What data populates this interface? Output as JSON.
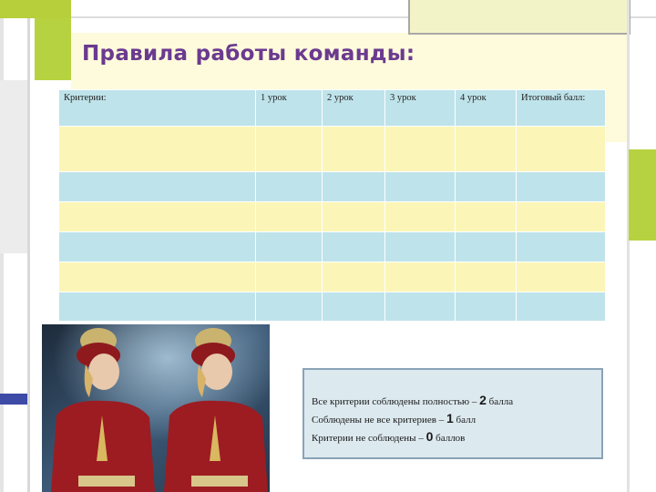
{
  "slide": {
    "title": "Правила работы команды:"
  },
  "table": {
    "headers": [
      "Критерии:",
      "1 урок",
      "2 урок",
      "3 урок",
      "4 урок",
      "Итоговый балл:"
    ],
    "rows": [
      [
        "",
        "",
        "",
        "",
        "",
        ""
      ],
      [
        "",
        "",
        "",
        "",
        "",
        ""
      ],
      [
        "",
        "",
        "",
        "",
        "",
        ""
      ],
      [
        "",
        "",
        "",
        "",
        "",
        ""
      ],
      [
        "",
        "",
        "",
        "",
        "",
        ""
      ],
      [
        "",
        "",
        "",
        "",
        "",
        ""
      ]
    ]
  },
  "scoring": {
    "line1": {
      "prefix": "Все критерии соблюдены полностью – ",
      "value": "2",
      "suffix": " балла"
    },
    "line2": {
      "prefix": "Соблюдены не все критериев – ",
      "value": "1",
      "suffix": " балл"
    },
    "line3": {
      "prefix": "Критерии не соблюдены – ",
      "value": "0",
      "suffix": " баллов"
    }
  },
  "colors": {
    "title": "#6b3a8f",
    "row_blue": "#bfe3ea",
    "row_yellow": "#fbf6b8",
    "accent_green": "#b7d240",
    "accent_blue": "#3d4aa6"
  }
}
